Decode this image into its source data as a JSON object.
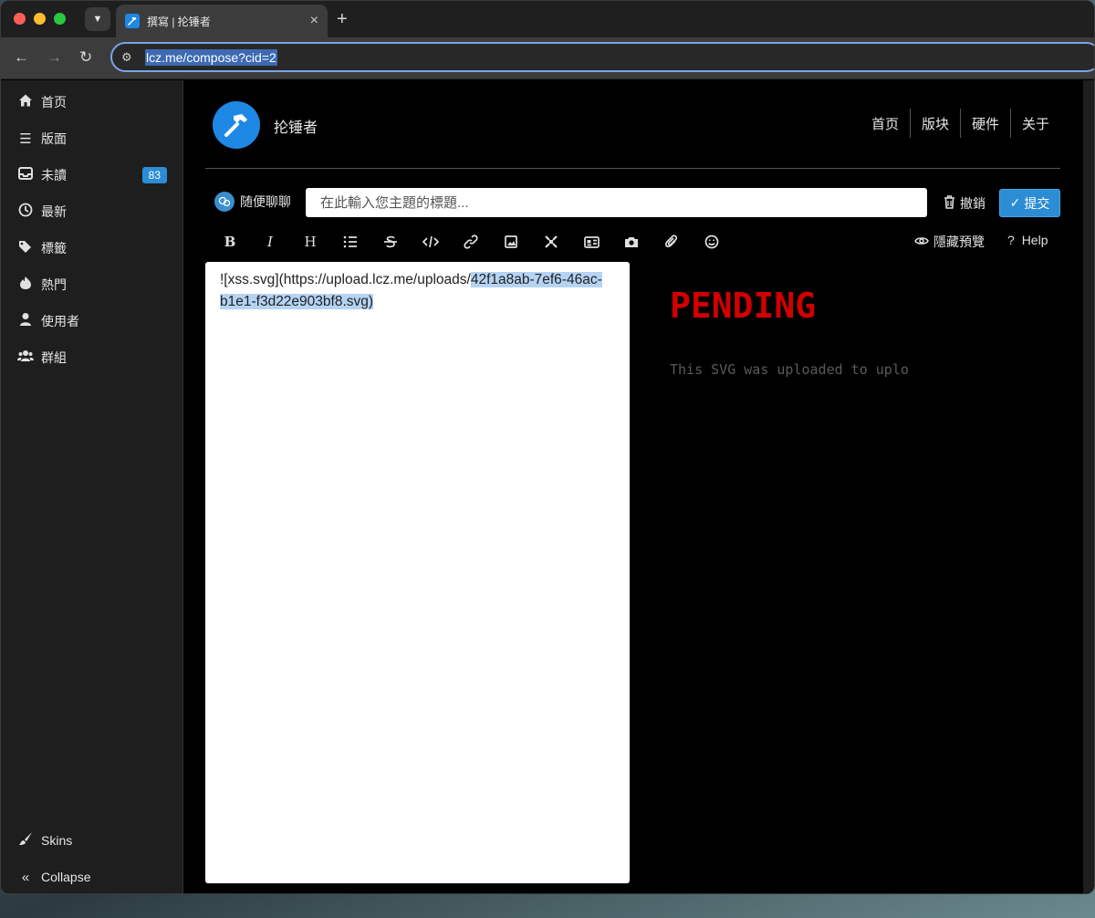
{
  "browser": {
    "tab_title": "撰寫 | 抡锤者",
    "new_tab": "+",
    "url": "lcz.me/compose?cid=2"
  },
  "sidebar": {
    "items": [
      {
        "label": "首页",
        "icon": "home-icon"
      },
      {
        "label": "版面",
        "icon": "list-icon"
      },
      {
        "label": "未讀",
        "icon": "inbox-icon",
        "badge": "83"
      },
      {
        "label": "最新",
        "icon": "clock-icon"
      },
      {
        "label": "標籤",
        "icon": "tags-icon"
      },
      {
        "label": "熱門",
        "icon": "fire-icon"
      },
      {
        "label": "使用者",
        "icon": "user-icon"
      },
      {
        "label": "群組",
        "icon": "users-icon"
      }
    ],
    "bottom": [
      {
        "label": "Skins",
        "icon": "paintbrush-icon"
      },
      {
        "label": "Collapse",
        "icon": "double-chevron-left-icon"
      }
    ]
  },
  "header": {
    "brand_name": "抡锤者",
    "nav": [
      "首页",
      "版块",
      "硬件",
      "关于"
    ]
  },
  "composer": {
    "category": "随便聊聊",
    "title_placeholder": "在此輸入您主題的標題...",
    "discard_label": "撤銷",
    "submit_label": "提交",
    "toolbar_icons": [
      "bold",
      "italic",
      "heading",
      "list",
      "strikethrough",
      "code",
      "link",
      "picture",
      "zen",
      "thumbs",
      "camera",
      "attachment",
      "emoji"
    ],
    "preview_toggle": "隱藏預覽",
    "help_label": "Help",
    "editor_text_plain": "![xss.svg](https://upload.lcz.me/uploads/",
    "editor_text_selected": "42f1a8ab-7ef6-46ac-b1e1-f3d22e903bf8.svg)",
    "preview_heading": "PENDING",
    "preview_text": "This SVG was uploaded to uplo"
  },
  "colors": {
    "accent": "#2c8cd4",
    "brand_blue": "#1e88e5",
    "preview_red": "#d00000"
  }
}
